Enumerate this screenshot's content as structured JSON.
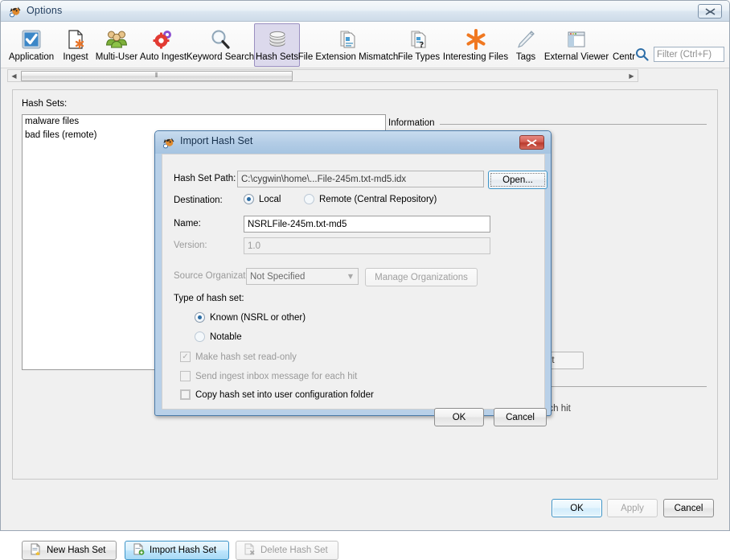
{
  "window": {
    "title": "Options",
    "icon": "autopsy-dog-icon",
    "close_label": "✕"
  },
  "toolbar": {
    "items": [
      {
        "label": "Application",
        "icon": "application-checkbox-icon",
        "selected": false
      },
      {
        "label": "Ingest",
        "icon": "ingest-document-star-icon",
        "selected": false
      },
      {
        "label": "Multi-User",
        "icon": "multi-user-people-icon",
        "selected": false
      },
      {
        "label": "Auto Ingest",
        "icon": "auto-ingest-gears-icon",
        "selected": false
      },
      {
        "label": "Keyword Search",
        "icon": "magnifier-icon",
        "selected": false
      },
      {
        "label": "Hash Sets",
        "icon": "database-cylinder-icon",
        "selected": true
      },
      {
        "label": "File Extension Mismatch",
        "icon": "file-extension-question-icon",
        "selected": false
      },
      {
        "label": "File Types",
        "icon": "file-types-question-icon",
        "selected": false
      },
      {
        "label": "Interesting Files",
        "icon": "asterisk-star-icon",
        "selected": false
      },
      {
        "label": "Tags",
        "icon": "tag-label-icon",
        "selected": false
      },
      {
        "label": "External Viewer",
        "icon": "external-window-icon",
        "selected": false
      },
      {
        "label": "Centr",
        "icon": "central-repository-icon",
        "selected": false
      }
    ],
    "search_icon": "search-icon",
    "filter_placeholder": "Filter (Ctrl+F)",
    "filter_value": "",
    "scroll_left_arrow": "◀",
    "scroll_right_arrow": "▶",
    "scroll_grip": "⦀"
  },
  "main_panel": {
    "hash_sets_label": "Hash Sets:",
    "hash_sets": [
      "malware files",
      "bad files (remote)"
    ],
    "information_label": "Information",
    "occluded_button_text": "et",
    "occluded_text": "ach hit",
    "buttons": {
      "new_hash_set": "New Hash Set",
      "import_hash_set": "Import Hash Set",
      "delete_hash_set": "Delete Hash Set"
    }
  },
  "footer": {
    "ok": "OK",
    "apply": "Apply",
    "cancel": "Cancel"
  },
  "dialog": {
    "title": "Import Hash Set",
    "icon": "autopsy-dog-icon",
    "close_label": "✕",
    "hash_set_path_label": "Hash Set Path:",
    "hash_set_path_value": "C:\\cygwin\\home\\...File-245m.txt-md5.idx",
    "open_button": "Open...",
    "destination_label": "Destination:",
    "destination_local": "Local",
    "destination_remote": "Remote (Central Repository)",
    "destination_selected": "Local",
    "name_label": "Name:",
    "name_value": "NSRLFile-245m.txt-md5",
    "version_label": "Version:",
    "version_value": "1.0",
    "source_org_label": "Source Organization:",
    "source_org_value": "Not Specified",
    "source_org_arrow": "▼",
    "manage_orgs_button": "Manage Organizations",
    "type_label": "Type of hash set:",
    "type_known": "Known (NSRL or other)",
    "type_notable": "Notable",
    "type_selected": "Known (NSRL or other)",
    "check_readonly": "Make hash set read-only",
    "check_readonly_checked": true,
    "check_readonly_mark": "✓",
    "check_ingest_inbox": "Send ingest inbox message for each hit",
    "check_ingest_inbox_checked": false,
    "check_copy_config": "Copy hash set into user configuration folder",
    "check_copy_config_checked": false,
    "ok_button": "OK",
    "cancel_button": "Cancel"
  },
  "colors": {
    "selection_purple": "#9a8fc0",
    "selection_fill": "#dcd9ec",
    "highlight_blue": "#3c94c8",
    "dialog_border": "#4a7aa8",
    "close_red": "#b93a2d"
  }
}
